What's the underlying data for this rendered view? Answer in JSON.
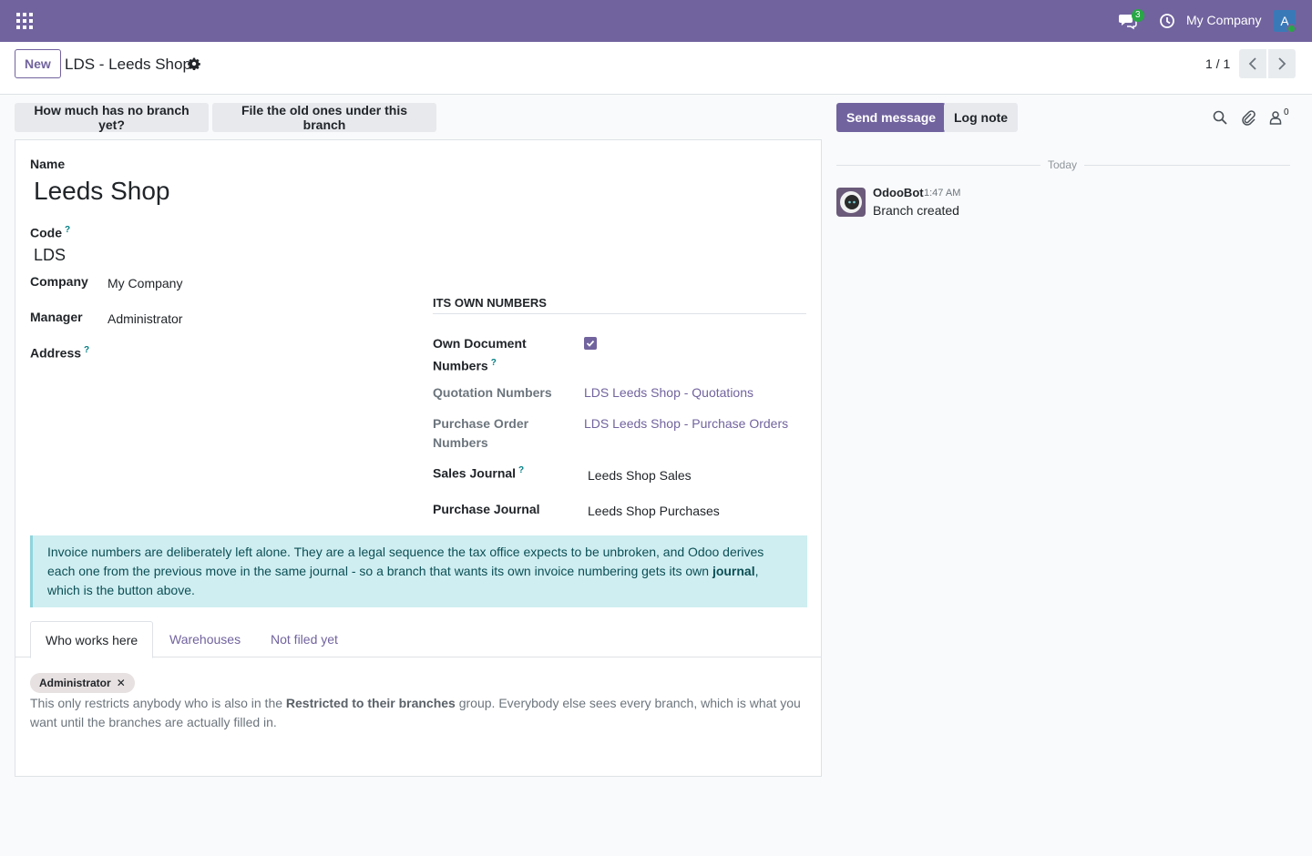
{
  "navbar": {
    "chat_badge": "3",
    "company": "My Company",
    "avatar_letter": "A"
  },
  "control_panel": {
    "new_label": "New",
    "title": "LDS - Leeds Shop",
    "pager": "1 / 1"
  },
  "actions": {
    "no_branch": "How much has no branch yet?",
    "file_old": "File the old ones under this branch"
  },
  "form": {
    "name_label": "Name",
    "name_value": "Leeds Shop",
    "code_label": "Code",
    "code_value": "LDS",
    "company_label": "Company",
    "company_value": "My Company",
    "manager_label": "Manager",
    "manager_value": "Administrator",
    "address_label": "Address",
    "help_mark": "?",
    "section_title": "Its own numbers",
    "own_doc_label_1": "Own Document",
    "own_doc_label_2": "Numbers",
    "own_doc_checked": true,
    "quotation_label": "Quotation Numbers",
    "quotation_value": "LDS Leeds Shop - Quotations",
    "po_label_1": "Purchase Order",
    "po_label_2": "Numbers",
    "po_value": "LDS Leeds Shop - Purchase Orders",
    "sales_journal_label": "Sales Journal",
    "sales_journal_value": "Leeds Shop Sales",
    "purchase_journal_label": "Purchase Journal",
    "purchase_journal_value": "Leeds Shop Purchases"
  },
  "alert": {
    "text_before": "Invoice numbers are deliberately left alone. They are a legal sequence the tax office expects to be unbroken, and Odoo derives each one from the previous move in the same journal - so a branch that wants its own invoice numbering gets its own ",
    "bold": "journal",
    "text_after": ", which is the button above."
  },
  "tabs": [
    "Who works here",
    "Warehouses",
    "Not filed yet"
  ],
  "users_tab": {
    "tag": "Administrator",
    "note_before": "This only restricts anybody who is also in the ",
    "note_bold": "Restricted to their branches",
    "note_after": " group. Everybody else sees every branch, which is what you want until the branches are actually filled in."
  },
  "chatter": {
    "send_label": "Send message",
    "log_label": "Log note",
    "follower_count": "0",
    "date_label": "Today",
    "author": "OdooBot",
    "time": "1:47 AM",
    "body": "Branch created"
  },
  "colors": {
    "brand": "#71639e",
    "alert_bg": "#cfeef1",
    "online": "#28a745"
  }
}
